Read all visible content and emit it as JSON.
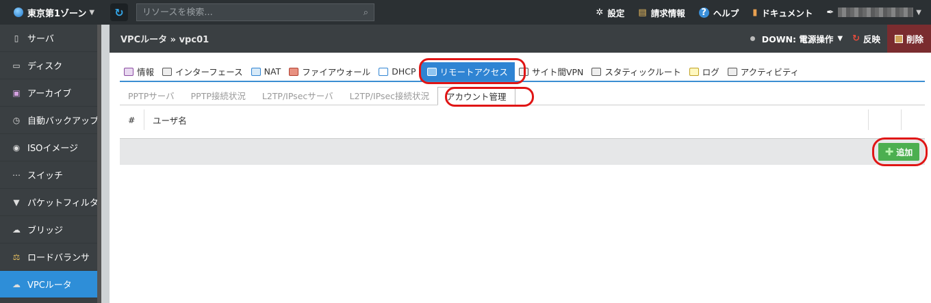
{
  "topbar": {
    "zone": "東京第1ゾーン",
    "search_placeholder": "リソースを検索...",
    "menu": [
      "設定",
      "請求情報",
      "ヘルプ",
      "ドキュメント"
    ]
  },
  "sidebar": {
    "items": [
      {
        "label": "サーバ",
        "icon": "server-icon"
      },
      {
        "label": "ディスク",
        "icon": "disk-icon"
      },
      {
        "label": "アーカイブ",
        "icon": "archive-icon"
      },
      {
        "label": "自動バックアップ",
        "icon": "clock-icon"
      },
      {
        "label": "ISOイメージ",
        "icon": "cd-icon"
      },
      {
        "label": "スイッチ",
        "icon": "switch-icon"
      },
      {
        "label": "パケットフィルタ",
        "icon": "filter-icon"
      },
      {
        "label": "ブリッジ",
        "icon": "bridge-icon"
      },
      {
        "label": "ロードバランサ",
        "icon": "balance-icon"
      },
      {
        "label": "VPCルータ",
        "icon": "cloud-icon",
        "active": true
      }
    ]
  },
  "header": {
    "breadcrumb": "VPCルータ » vpc01",
    "status": "DOWN: 電源操作",
    "reflect": "反映",
    "delete": "削除"
  },
  "tabs": [
    "情報",
    "インターフェース",
    "NAT",
    "ファイアウォール",
    "DHCP",
    "リモートアクセス",
    "サイト間VPN",
    "スタティックルート",
    "ログ",
    "アクティビティ"
  ],
  "active_tab": "リモートアクセス",
  "subtabs": [
    "PPTPサーバ",
    "PPTP接続状況",
    "L2TP/IPsecサーバ",
    "L2TP/IPsec接続状況",
    "アカウント管理"
  ],
  "active_subtab": "アカウント管理",
  "table": {
    "columns": [
      "#",
      "ユーザ名"
    ]
  },
  "add_button": "追加",
  "colors": {
    "accent": "#2f84d3",
    "highlight": "#e01515",
    "add": "#4caf50",
    "delete_bg": "#7a2c2f"
  }
}
